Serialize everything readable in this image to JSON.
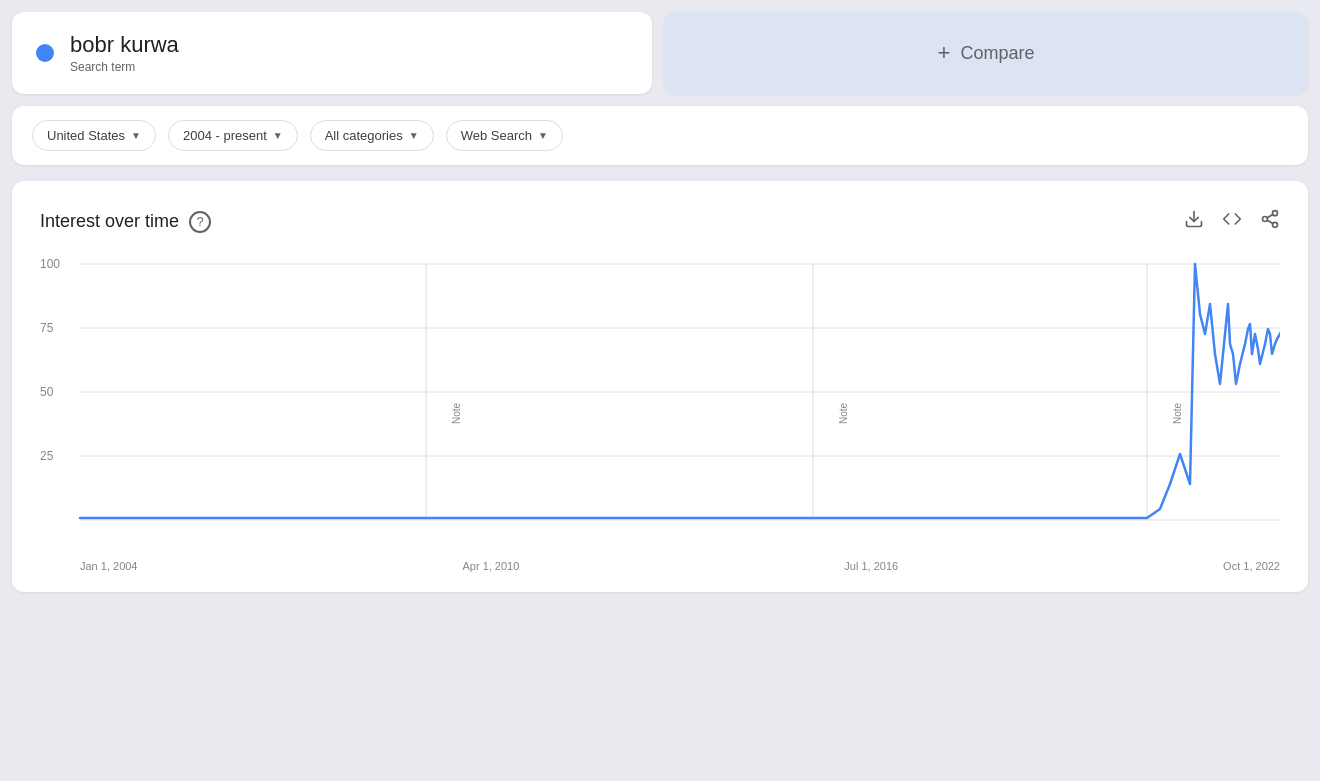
{
  "search_term": {
    "term": "bobr kurwa",
    "label": "Search term"
  },
  "compare": {
    "label": "Compare",
    "plus": "+"
  },
  "filters": {
    "region": {
      "label": "United States",
      "chevron": "▼"
    },
    "timeframe": {
      "label": "2004 - present",
      "chevron": "▼"
    },
    "category": {
      "label": "All categories",
      "chevron": "▼"
    },
    "search_type": {
      "label": "Web Search",
      "chevron": "▼"
    }
  },
  "chart": {
    "title": "Interest over time",
    "help_label": "?",
    "x_labels": [
      "Jan 1, 2004",
      "Apr 1, 2010",
      "Jul 1, 2016",
      "Oct 1, 2022"
    ],
    "y_labels": [
      "100",
      "75",
      "50",
      "25"
    ],
    "note_label": "Note",
    "download_icon": "⬇",
    "embed_icon": "<>",
    "share_icon": "⤴"
  }
}
